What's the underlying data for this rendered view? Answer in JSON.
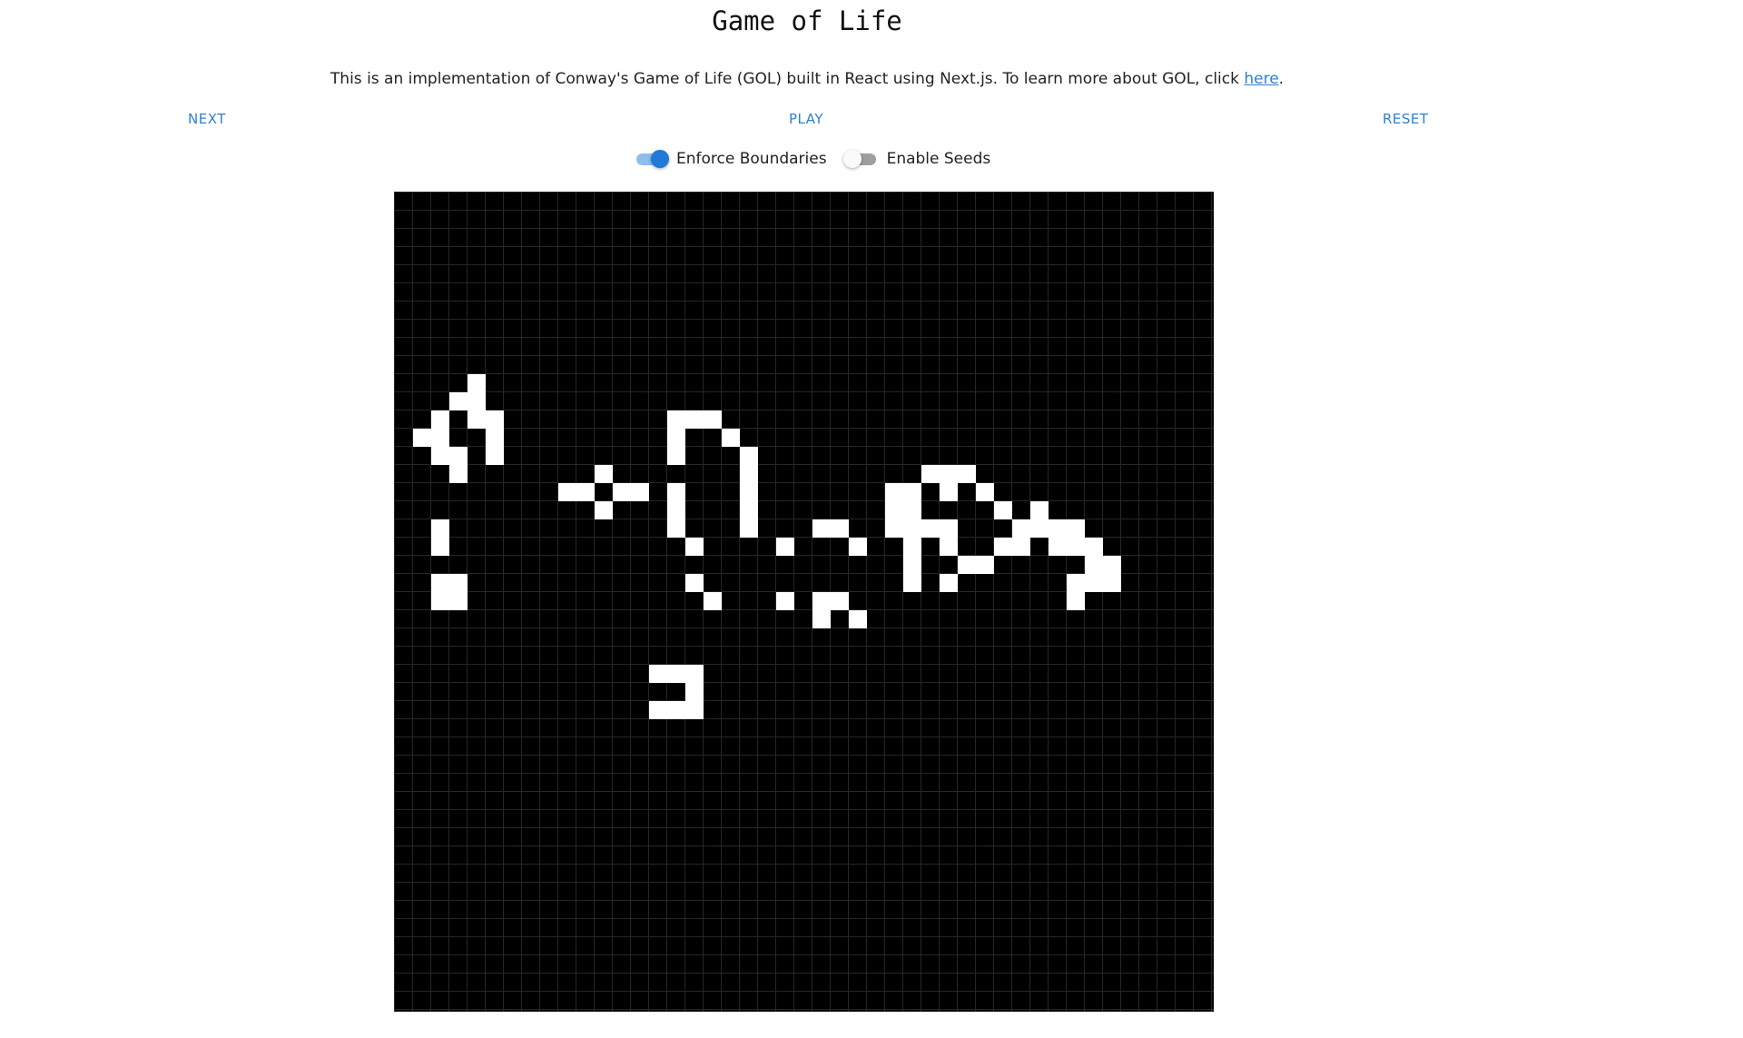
{
  "page": {
    "title": "Game of Life",
    "intro_text": "This is an implementation of Conway's Game of Life (GOL) built in React using Next.js. To learn more about GOL, click ",
    "intro_link": "here",
    "intro_end": "."
  },
  "controls": {
    "next_label": "NEXT",
    "play_label": "PLAY",
    "reset_label": "RESET"
  },
  "toggles": {
    "boundaries": {
      "label": "Enforce Boundaries",
      "checked": true
    },
    "seeds": {
      "label": "Enable Seeds",
      "checked": false
    }
  },
  "colors": {
    "accent": "#2f7fd0",
    "live_cell": "#ffffff",
    "dead_cell": "#000000"
  },
  "board": {
    "cols": 45,
    "rows": 45,
    "live_cells": [
      [
        4,
        10
      ],
      [
        3,
        11
      ],
      [
        4,
        11
      ],
      [
        2,
        12
      ],
      [
        4,
        12
      ],
      [
        5,
        12
      ],
      [
        1,
        13
      ],
      [
        2,
        13
      ],
      [
        5,
        13
      ],
      [
        2,
        14
      ],
      [
        3,
        14
      ],
      [
        5,
        14
      ],
      [
        3,
        15
      ],
      [
        2,
        18
      ],
      [
        2,
        19
      ],
      [
        2,
        21
      ],
      [
        3,
        21
      ],
      [
        2,
        22
      ],
      [
        3,
        22
      ],
      [
        11,
        15
      ],
      [
        9,
        16
      ],
      [
        10,
        16
      ],
      [
        12,
        16
      ],
      [
        13,
        16
      ],
      [
        11,
        17
      ],
      [
        15,
        12
      ],
      [
        16,
        12
      ],
      [
        17,
        12
      ],
      [
        15,
        13
      ],
      [
        18,
        13
      ],
      [
        15,
        14
      ],
      [
        19,
        14
      ],
      [
        19,
        15
      ],
      [
        15,
        16
      ],
      [
        19,
        16
      ],
      [
        15,
        17
      ],
      [
        19,
        17
      ],
      [
        15,
        18
      ],
      [
        19,
        18
      ],
      [
        16,
        19
      ],
      [
        16,
        21
      ],
      [
        17,
        22
      ],
      [
        21,
        19
      ],
      [
        23,
        18
      ],
      [
        24,
        18
      ],
      [
        25,
        19
      ],
      [
        21,
        22
      ],
      [
        23,
        22
      ],
      [
        24,
        22
      ],
      [
        23,
        23
      ],
      [
        25,
        23
      ],
      [
        29,
        15
      ],
      [
        30,
        15
      ],
      [
        31,
        15
      ],
      [
        27,
        16
      ],
      [
        28,
        16
      ],
      [
        30,
        16
      ],
      [
        32,
        16
      ],
      [
        27,
        17
      ],
      [
        28,
        17
      ],
      [
        33,
        17
      ],
      [
        35,
        17
      ],
      [
        27,
        18
      ],
      [
        28,
        18
      ],
      [
        29,
        18
      ],
      [
        30,
        18
      ],
      [
        34,
        18
      ],
      [
        35,
        18
      ],
      [
        36,
        18
      ],
      [
        37,
        18
      ],
      [
        28,
        19
      ],
      [
        30,
        19
      ],
      [
        33,
        19
      ],
      [
        34,
        19
      ],
      [
        36,
        19
      ],
      [
        37,
        19
      ],
      [
        38,
        19
      ],
      [
        28,
        20
      ],
      [
        31,
        20
      ],
      [
        32,
        20
      ],
      [
        38,
        20
      ],
      [
        39,
        20
      ],
      [
        28,
        21
      ],
      [
        30,
        21
      ],
      [
        37,
        21
      ],
      [
        38,
        21
      ],
      [
        39,
        21
      ],
      [
        37,
        22
      ],
      [
        14,
        26
      ],
      [
        15,
        26
      ],
      [
        16,
        26
      ],
      [
        16,
        27
      ],
      [
        14,
        28
      ],
      [
        15,
        28
      ],
      [
        16,
        28
      ]
    ]
  }
}
